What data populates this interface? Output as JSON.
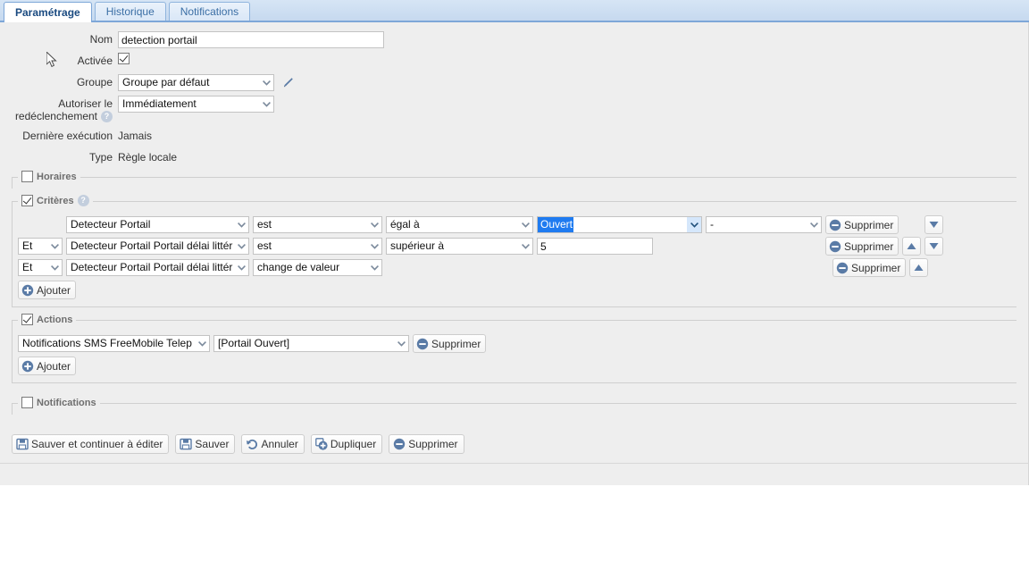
{
  "tabs": [
    {
      "label": "Paramétrage",
      "active": true
    },
    {
      "label": "Historique",
      "active": false
    },
    {
      "label": "Notifications",
      "active": false
    }
  ],
  "form": {
    "nom_label": "Nom",
    "nom_value": "detection portail",
    "activee_label": "Activée",
    "activee_checked": true,
    "groupe_label": "Groupe",
    "groupe_value": "Groupe par défaut",
    "edit_group_icon": "pencil-icon",
    "retrigger_label_line1": "Autoriser le",
    "retrigger_label_line2": "redéclenchement",
    "retrigger_value": "Immédiatement",
    "last_exec_label": "Dernière exécution",
    "last_exec_value": "Jamais",
    "type_label": "Type",
    "type_value": "Règle locale"
  },
  "sections": {
    "horaires": {
      "legend": "Horaires",
      "checked": false
    },
    "criteres": {
      "legend": "Critères",
      "checked": true,
      "help": "?"
    },
    "actions": {
      "legend": "Actions",
      "checked": true
    },
    "notifications": {
      "legend": "Notifications",
      "checked": false
    }
  },
  "criteria": {
    "rows": [
      {
        "operator": null,
        "source": "Detecteur Portail",
        "verb": "est",
        "comparator": "égal à",
        "value": "Ouvert",
        "value_type": "select",
        "value_focused": true,
        "extra": "-",
        "delete_label": "Supprimer",
        "move_up": false,
        "move_down": true
      },
      {
        "operator": "Et",
        "source": "Detecteur Portail Portail délai littér",
        "verb": "est",
        "comparator": "supérieur à",
        "value": "5",
        "value_type": "text",
        "value_focused": false,
        "extra": null,
        "delete_label": "Supprimer",
        "move_up": true,
        "move_down": true
      },
      {
        "operator": "Et",
        "source": "Detecteur Portail Portail délai littér",
        "verb": "change de valeur",
        "comparator": null,
        "value": null,
        "value_type": null,
        "value_focused": false,
        "extra": null,
        "delete_label": "Supprimer",
        "move_up": true,
        "move_down": false
      }
    ],
    "add_label": "Ajouter"
  },
  "actions": {
    "rows": [
      {
        "target": "Notifications SMS FreeMobile Telep",
        "message": "[Portail Ouvert]",
        "delete_label": "Supprimer"
      }
    ],
    "add_label": "Ajouter"
  },
  "toolbar": {
    "buttons": [
      {
        "label": "Sauver et continuer à éditer",
        "icon": "save-icon"
      },
      {
        "label": "Sauver",
        "icon": "save-icon"
      },
      {
        "label": "Annuler",
        "icon": "undo-icon"
      },
      {
        "label": "Dupliquer",
        "icon": "duplicate-icon"
      },
      {
        "label": "Supprimer",
        "icon": "delete-icon"
      }
    ]
  },
  "colors": {
    "tabbar_bg": "#cfe0f2",
    "tabbar_border": "#7ea7d8",
    "page_bg": "#eeeeee",
    "accent_blue": "#5a7ba6",
    "selection_blue": "#1f7bf0",
    "legend_text": "#6e6e6e"
  }
}
